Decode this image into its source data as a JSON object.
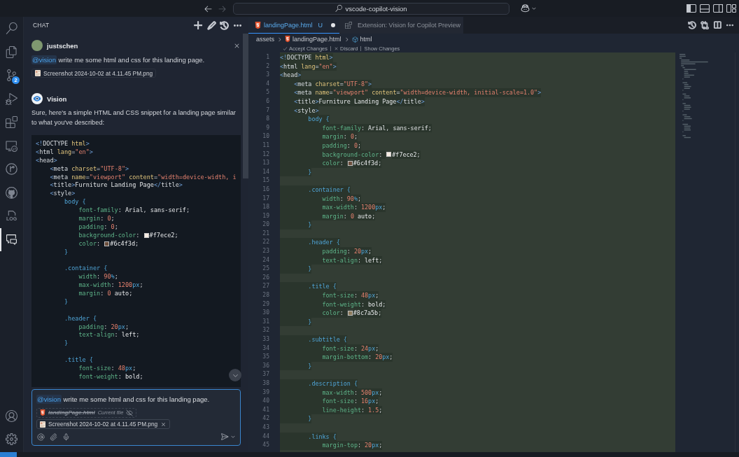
{
  "title_bar": {
    "navigation": [
      {
        "kind": "back",
        "enabled": true
      },
      {
        "kind": "forward",
        "enabled": false
      }
    ],
    "search": {
      "text": "vscode-copilot-vision"
    },
    "layout_toggles": [
      {
        "kind": "sidebar-left",
        "on": true
      },
      {
        "kind": "panel",
        "on": false
      },
      {
        "kind": "sidebar-right",
        "on": false
      },
      {
        "kind": "customize",
        "on": false
      }
    ]
  },
  "activity_bar": {
    "items": [
      {
        "kind": "search",
        "selected": false
      },
      {
        "kind": "explorer",
        "selected": false
      },
      {
        "kind": "source-control",
        "selected": false,
        "badge": "2"
      },
      {
        "kind": "run-debug",
        "selected": false
      },
      {
        "kind": "extensions",
        "selected": false
      },
      {
        "kind": "remote",
        "selected": false
      },
      {
        "kind": "git-graph",
        "selected": false
      },
      {
        "kind": "github",
        "selected": false
      },
      {
        "kind": "log",
        "selected": false,
        "label": "LOG"
      },
      {
        "kind": "chat",
        "selected": true
      }
    ],
    "bottom_items": [
      {
        "kind": "account"
      },
      {
        "kind": "settings"
      }
    ]
  },
  "chat": {
    "title": "CHAT",
    "actions": [
      {
        "kind": "new"
      },
      {
        "kind": "edit"
      },
      {
        "kind": "history"
      },
      {
        "kind": "more"
      }
    ],
    "messages": [
      {
        "kind": "user",
        "author": "justschen",
        "mention": "@vision",
        "text": "write me some html and css for this landing page.",
        "attachments": [
          {
            "name": "Screenshot 2024-10-02 at 4.11.45 PM.png"
          }
        ]
      },
      {
        "kind": "assistant",
        "author": "Vision",
        "text": "Sure, here's a simple HTML and CSS snippet for a landing page similar to what you've described:",
        "code_sections": [
          {
            "lines": [
              "<!DOCTYPE html>",
              "<html lang=\"en\">",
              "<head>",
              "    <meta charset=\"UTF-8\">",
              "    <meta name=\"viewport\" content=\"width=device-width, i",
              "    <title>Furniture Landing Page</title>",
              "    <style>",
              "        body {",
              "            font-family: Arial, sans-serif;",
              "            margin: 0;",
              "            padding: 0;",
              "            background-color: #f7ece2;",
              "            color: #6c4f3d;",
              "        }"
            ]
          },
          {
            "lines": [
              "        .container {",
              "            width: 90%;",
              "            max-width: 1200px;",
              "            margin: 0 auto;",
              "        }"
            ]
          },
          {
            "lines": [
              "        .header {",
              "            padding: 20px;",
              "            text-align: left;",
              "        }"
            ]
          },
          {
            "lines": [
              "        .title {",
              "            font-size: 48px;",
              "            font-weight: bold;"
            ]
          }
        ]
      }
    ],
    "input": {
      "mention": "@vision",
      "value": "write me some html and css for this landing page.",
      "current_file": {
        "name": "landingPage.html",
        "label": "Current file",
        "included": false
      },
      "attachments": [
        {
          "name": "Screenshot 2024-10-02 at 4.11.45 PM.png"
        }
      ],
      "tools": [
        {
          "kind": "mention"
        },
        {
          "kind": "attach"
        },
        {
          "kind": "voice"
        }
      ]
    }
  },
  "editor": {
    "tabs": [
      {
        "kind": "html",
        "label": "landingPage.html",
        "status": "U",
        "dirty": true,
        "selected": true
      },
      {
        "kind": "extension",
        "label": "Extension: Vision for Copilot Preview",
        "selected": false
      }
    ],
    "actions": [
      {
        "kind": "timeline"
      },
      {
        "kind": "compare"
      },
      {
        "kind": "split"
      },
      {
        "kind": "more"
      }
    ],
    "breadcrumb": [
      {
        "kind": "folder",
        "label": "assets"
      },
      {
        "kind": "html",
        "label": "landingPage.html"
      },
      {
        "kind": "element",
        "label": "html"
      }
    ],
    "code_lens": [
      {
        "kind": "accept",
        "label": "Accept Changes"
      },
      {
        "kind": "discard",
        "label": "Discard"
      },
      {
        "kind": "show",
        "label": "Show Changes"
      }
    ],
    "pending_changes": true,
    "lines": [
      {
        "number": "1",
        "text": "<!DOCTYPE html>"
      },
      {
        "number": "2",
        "text": "<html lang=\"en\">"
      },
      {
        "number": "3",
        "text": "<head>"
      },
      {
        "number": "4",
        "text": "    <meta charset=\"UTF-8\">"
      },
      {
        "number": "5",
        "text": "    <meta name=\"viewport\" content=\"width=device-width, initial-scale=1.0\">"
      },
      {
        "number": "6",
        "text": "    <title>Furniture Landing Page</title>"
      },
      {
        "number": "7",
        "text": "    <style>"
      },
      {
        "number": "8",
        "text": "        body {"
      },
      {
        "number": "9",
        "text": "            font-family: Arial, sans-serif;"
      },
      {
        "number": "10",
        "text": "            margin: 0;"
      },
      {
        "number": "11",
        "text": "            padding: 0;"
      },
      {
        "number": "12",
        "text": "            background-color: #f7ece2;"
      },
      {
        "number": "13",
        "text": "            color: #6c4f3d;"
      },
      {
        "number": "14",
        "text": "        }"
      },
      {
        "number": "15"
      },
      {
        "number": "16",
        "text": "        .container {"
      },
      {
        "number": "17",
        "text": "            width: 90%;"
      },
      {
        "number": "18",
        "text": "            max-width: 1200px;"
      },
      {
        "number": "19",
        "text": "            margin: 0 auto;"
      },
      {
        "number": "20",
        "text": "        }"
      },
      {
        "number": "21"
      },
      {
        "number": "22",
        "text": "        .header {"
      },
      {
        "number": "23",
        "text": "            padding: 20px;"
      },
      {
        "number": "24",
        "text": "            text-align: left;"
      },
      {
        "number": "25",
        "text": "        }"
      },
      {
        "number": "26"
      },
      {
        "number": "27",
        "text": "        .title {"
      },
      {
        "number": "28",
        "text": "            font-size: 48px;"
      },
      {
        "number": "29",
        "text": "            font-weight: bold;"
      },
      {
        "number": "30",
        "text": "            color: #8c7a5b;"
      },
      {
        "number": "31",
        "text": "        }"
      },
      {
        "number": "32"
      },
      {
        "number": "33",
        "text": "        .subtitle {"
      },
      {
        "number": "34",
        "text": "            font-size: 24px;"
      },
      {
        "number": "35",
        "text": "            margin-bottom: 20px;"
      },
      {
        "number": "36",
        "text": "        }"
      },
      {
        "number": "37"
      },
      {
        "number": "38",
        "text": "        .description {"
      },
      {
        "number": "39",
        "text": "            max-width: 500px;"
      },
      {
        "number": "40",
        "text": "            font-size: 16px;"
      },
      {
        "number": "41",
        "text": "            line-height: 1.5;"
      },
      {
        "number": "42",
        "text": "        }"
      },
      {
        "number": "43"
      },
      {
        "number": "44",
        "text": "        .links {"
      },
      {
        "number": "45",
        "text": "            margin-top: 20px;"
      }
    ]
  }
}
